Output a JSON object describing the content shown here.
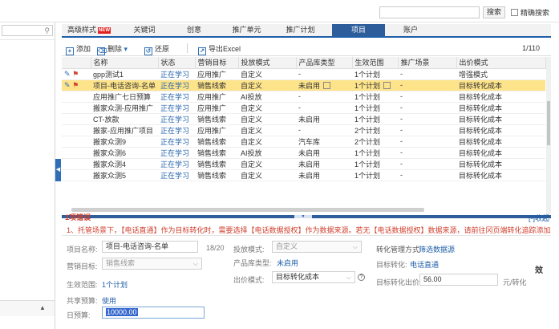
{
  "topbar": {
    "search_button": "搜索",
    "exact_search_label": "精确搜索"
  },
  "tabs": [
    {
      "label": "高级样式",
      "badge": "NEW"
    },
    {
      "label": "关键词"
    },
    {
      "label": "创意"
    },
    {
      "label": "推广单元"
    },
    {
      "label": "推广计划"
    },
    {
      "label": "项目",
      "active": true
    },
    {
      "label": "账户"
    }
  ],
  "toolbar": {
    "add": "添加",
    "delete": "删除",
    "restore": "还原",
    "export": "导出Excel",
    "pager": "1/110"
  },
  "table": {
    "columns": [
      "名称",
      "状态",
      "营销目标",
      "投放模式",
      "产品库类型",
      "生效范围",
      "推广场景",
      "出价模式"
    ],
    "rows": [
      {
        "name": "gpp测试1",
        "status": "正在学习",
        "goal": "应用推广",
        "mode": "自定义",
        "lib": "-",
        "scope": "1个计划",
        "scene": "-",
        "bid": "增强模式",
        "icons": true
      },
      {
        "name": "项目-电话咨询-名单",
        "status": "正在学习",
        "goal": "销售线索",
        "mode": "自定义",
        "lib": "未启用",
        "scope": "1个计划",
        "scene": "-",
        "bid": "目标转化成本",
        "selected": true,
        "icons": true
      },
      {
        "name": "应用推广七日预算",
        "status": "正在学习",
        "goal": "应用推广",
        "mode": "AI投放",
        "lib": "-",
        "scope": "1个计划",
        "scene": "-",
        "bid": "目标转化成本"
      },
      {
        "name": "搬家众测-应用推广",
        "status": "正在学习",
        "goal": "应用推广",
        "mode": "自定义",
        "lib": "-",
        "scope": "1个计划",
        "scene": "-",
        "bid": "目标转化成本"
      },
      {
        "name": "CT-放款",
        "status": "正在学习",
        "goal": "销售线索",
        "mode": "自定义",
        "lib": "未启用",
        "scope": "1个计划",
        "scene": "-",
        "bid": "目标转化成本"
      },
      {
        "name": "搬家-应用推广项目",
        "status": "正在学习",
        "goal": "应用推广",
        "mode": "自定义",
        "lib": "-",
        "scope": "2个计划",
        "scene": "-",
        "bid": "目标转化成本"
      },
      {
        "name": "搬家众测9",
        "status": "正在学习",
        "goal": "销售线索",
        "mode": "自定义",
        "lib": "汽车库",
        "scope": "2个计划",
        "scene": "-",
        "bid": "目标转化成本"
      },
      {
        "name": "搬家众测6",
        "status": "正在学习",
        "goal": "销售线索",
        "mode": "AI投放",
        "lib": "未启用",
        "scope": "1个计划",
        "scene": "-",
        "bid": "目标转化成本"
      },
      {
        "name": "搬家众测4",
        "status": "正在学习",
        "goal": "销售线索",
        "mode": "自定义",
        "lib": "未启用",
        "scope": "1个计划",
        "scene": "-",
        "bid": "目标转化成本"
      },
      {
        "name": "搬家众测5",
        "status": "正在学习",
        "goal": "销售线索",
        "mode": "自定义",
        "lib": "未启用",
        "scope": "1个计划",
        "scene": "-",
        "bid": "目标转化成本"
      }
    ]
  },
  "errors": {
    "title": "1项错误",
    "collapse": "[-]收起",
    "message": "1、托管场景下，【电话直通】作为目标转化时，需要选择【电话数据授权】作为数据来源。若无【电话数据授权】数据来源，请前往冈页端转化追踪添加"
  },
  "form": {
    "name_label": "项目名称:",
    "name_value": "项目-电话咨询-名单",
    "name_count": "18/20",
    "goal_label": "营销目标:",
    "goal_value": "销售线索",
    "scope_label": "生效范围:",
    "scope_value": "1个计划",
    "shared_budget_label": "共享预算:",
    "shared_budget_value": "使用",
    "daily_budget_label": "日预算:",
    "daily_budget_value": "10000.00",
    "mode_label": "投放模式:",
    "mode_value": "自定义",
    "lib_label": "产品库类型:",
    "lib_value": "未启用",
    "bid_label": "出价模式:",
    "bid_value": "目标转化成本",
    "conv_method_label": "转化管理方式",
    "conv_method_value": "筛选数据源",
    "conv_target_label": "目标转化:",
    "conv_target_value": "电话直通",
    "conv_bid_label": "目标转化出价:",
    "conv_bid_value": "56.00",
    "conv_bid_unit": "元/转化",
    "side_char": "效"
  },
  "colors": {
    "accent": "#2d5d9b",
    "selected_row": "#fde38a",
    "error": "#d0402f",
    "link": "#1f5fa8"
  }
}
